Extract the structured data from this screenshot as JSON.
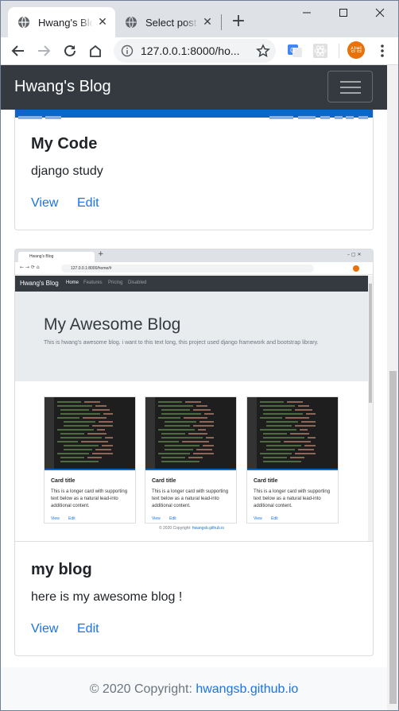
{
  "browser": {
    "tabs": [
      {
        "title": "Hwang's Blog",
        "active": true
      },
      {
        "title": "Select post to change",
        "active": false
      }
    ],
    "new_tab_label": "+",
    "window_controls": [
      "minimize",
      "maximize",
      "close"
    ],
    "address": "127.0.0.1:8000/ho...",
    "profile_initials": "상범",
    "accent_color": "#e8710a"
  },
  "navbar": {
    "brand": "Hwang's Blog",
    "background": "#343a40"
  },
  "posts": [
    {
      "title": "My Code",
      "text": "django study",
      "view_label": "View",
      "edit_label": "Edit",
      "image": "vscode-screenshot"
    },
    {
      "title": "my blog",
      "text": "here is my awesome blog !",
      "view_label": "View",
      "edit_label": "Edit",
      "image": {
        "tab_title": "Hwang's Blog",
        "url": "127.0.0.1:8000/home/#",
        "navbar": {
          "brand": "Hwang's Blog",
          "links": [
            "Home",
            "Features",
            "Pricing",
            "Disabled"
          ]
        },
        "jumbotron": {
          "heading": "My Awesome Blog",
          "text": "This is hwang's awesome blog. i want to this text long, this project used django framework and bootstrap library."
        },
        "cards": [
          {
            "title": "Card title",
            "text": "This is a longer card with supporting text below as a natural lead-into additional content.",
            "view": "View",
            "edit": "Edit"
          },
          {
            "title": "Card title",
            "text": "This is a longer card with supporting text below as a natural lead-into additional content.",
            "view": "View",
            "edit": "Edit"
          },
          {
            "title": "Card title",
            "text": "This is a longer card with supporting text below as a natural lead-into additional content.",
            "view": "View",
            "edit": "Edit"
          }
        ],
        "footer_prefix": "© 2020 Copyright:",
        "footer_link": "hwangsb.github.io"
      }
    }
  ],
  "footer": {
    "prefix": "© 2020 Copyright: ",
    "link": "hwangsb.github.io",
    "link_color": "#1a73e8"
  }
}
